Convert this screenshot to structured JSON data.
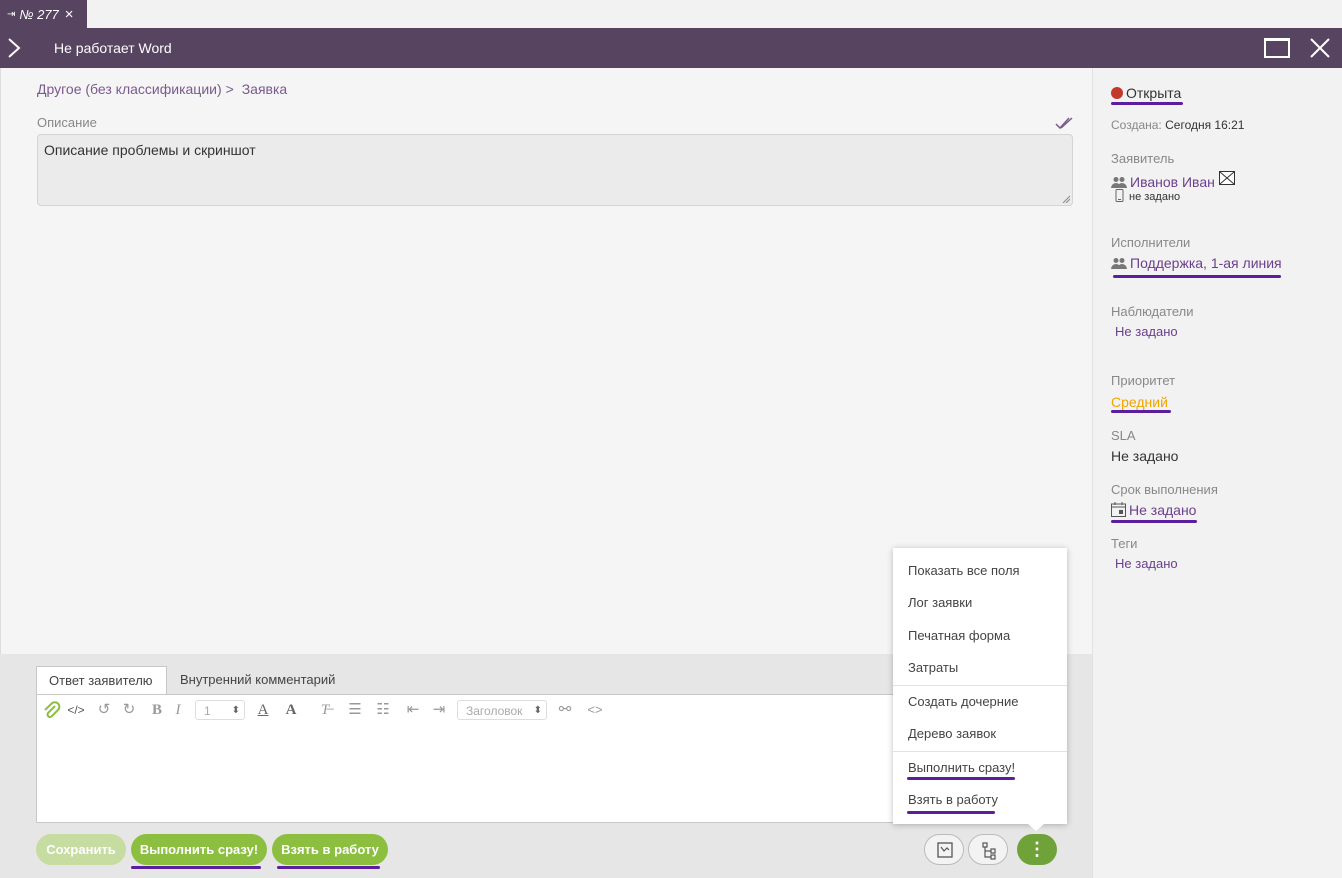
{
  "tab": {
    "label": "№ 277",
    "close": "×"
  },
  "header": {
    "title": "Не работает Word"
  },
  "breadcrumb": {
    "category": "Другое (без классификации)",
    "separator": ">",
    "type": "Заявка"
  },
  "description": {
    "label": "Описание",
    "value": "Описание проблемы и скриншот"
  },
  "editor": {
    "tabs": [
      "Ответ заявителю",
      "Внутренний комментарий"
    ],
    "font_size": "1",
    "heading_select": "Заголовок"
  },
  "buttons": {
    "save": "Сохранить",
    "complete_now": "Выполнить сразу!",
    "take_to_work": "Взять в работу",
    "more": "⋮"
  },
  "menu": {
    "items": [
      "Показать все поля",
      "Лог заявки",
      "Печатная форма",
      "Затраты",
      "Создать дочерние",
      "Дерево заявок",
      "Выполнить сразу!",
      "Взять в работу"
    ]
  },
  "sidebar": {
    "status": "Открыта",
    "status_color": "#c0392b",
    "created_label": "Создана:",
    "created_value": "Сегодня 16:21",
    "requester_label": "Заявитель",
    "requester_name": "Иванов Иван",
    "requester_phone": "не задано",
    "executors_label": "Исполнители",
    "executors_value": "Поддержка, 1-ая линия",
    "observers_label": "Наблюдатели",
    "observers_value": "Не задано",
    "priority_label": "Приоритет",
    "priority_value": "Средний",
    "priority_color": "#f0a500",
    "sla_label": "SLA",
    "sla_value": "Не задано",
    "deadline_label": "Срок выполнения",
    "deadline_value": "Не задано",
    "tags_label": "Теги",
    "tags_value": "Не задано"
  },
  "colors": {
    "header": "#564461",
    "accent_green": "#8cbf3f",
    "link": "#6b3f8c",
    "underline": "#5b1e9e"
  }
}
